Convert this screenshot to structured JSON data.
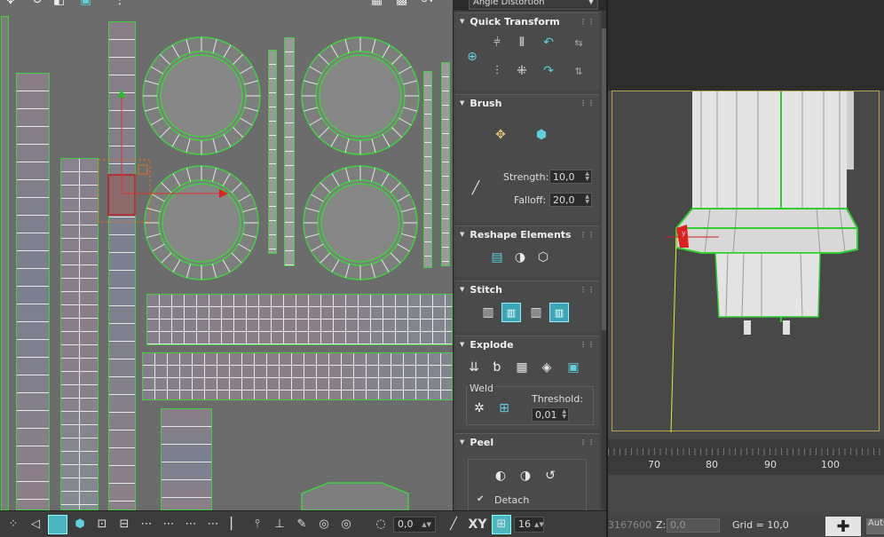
{
  "top_toolbar": {
    "angle_dropdown": "Angle Distortion"
  },
  "panel": {
    "rollouts": {
      "quick_transform": "Quick Transform",
      "brush": "Brush",
      "reshape": "Reshape Elements",
      "stitch": "Stitch",
      "explode": "Explode",
      "peel": "Peel"
    },
    "brush": {
      "strength_label": "Strength:",
      "strength_value": "10,0",
      "falloff_label": "Falloff:",
      "falloff_value": "20,0"
    },
    "explode": {
      "weld_label": "Weld",
      "threshold_label": "Threshold:",
      "threshold_value": "0,01"
    },
    "peel": {
      "detach_label": "Detach",
      "detach_checked": true
    }
  },
  "uv_toolbar": {
    "rotate_value": "0,0",
    "axis_label": "XY",
    "snap_value": "16"
  },
  "viewport": {
    "ruler_labels": [
      "70",
      "80",
      "90",
      "100"
    ],
    "status_x_value": "3167600",
    "z_label": "Z:",
    "z_value": "0,0",
    "grid_text": "Grid = 10,0",
    "auto_label": "Auto"
  },
  "colors": {
    "uv_edge": "#3fcf3f",
    "accent": "#3aa7b6",
    "gizmo_x": "#e0202a",
    "gizmo_y": "#20c020"
  }
}
